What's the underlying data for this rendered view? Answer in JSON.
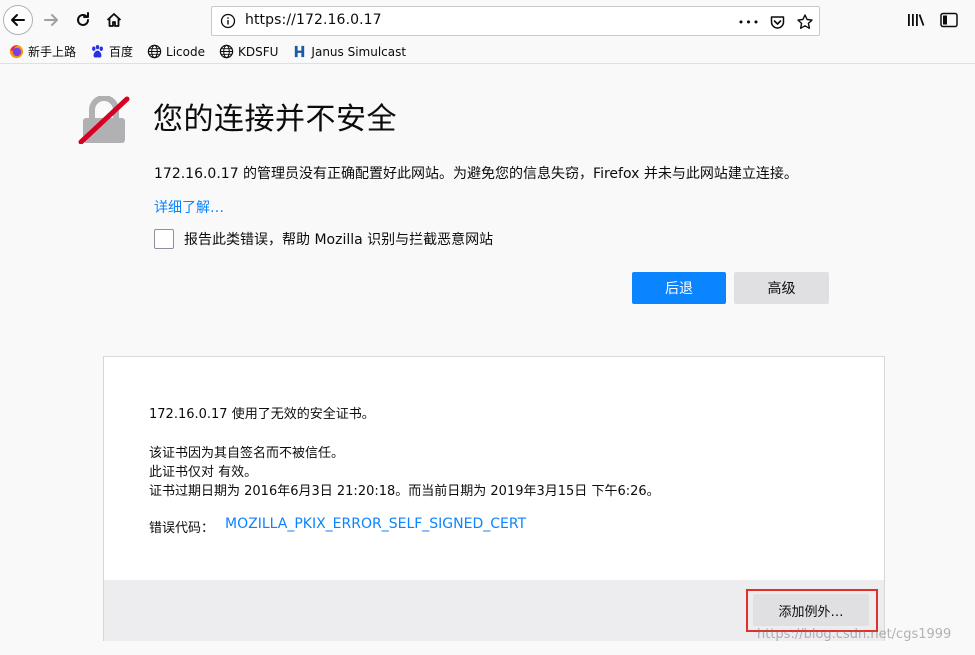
{
  "toolbar": {
    "url": "https://172.16.0.17",
    "more_glyph": "•••"
  },
  "bookmarks": [
    {
      "label": "新手上路",
      "icon": "firefox-icon"
    },
    {
      "label": "百度",
      "icon": "baidu-icon"
    },
    {
      "label": "Licode",
      "icon": "globe-icon"
    },
    {
      "label": "KDSFU",
      "icon": "globe-icon"
    },
    {
      "label": "Janus Simulcast",
      "icon": "janus-icon"
    }
  ],
  "error": {
    "title": "您的连接并不安全",
    "description": "172.16.0.17 的管理员没有正确配置好此网站。为避免您的信息失窃，Firefox 并未与此网站建立连接。",
    "learn_more": "详细了解…",
    "report_label": "报告此类错误，帮助 Mozilla 识别与拦截恶意网站",
    "back_button": "后退",
    "advanced_button": "高级"
  },
  "advanced": {
    "line1": "172.16.0.17 使用了无效的安全证书。",
    "line2": "该证书因为其自签名而不被信任。",
    "line3": "此证书仅对  有效。",
    "line4": "证书过期日期为 2016年6月3日 21:20:18。而当前日期为 2019年3月15日 下午6:26。",
    "error_code_label": "错误代码：",
    "error_code": "MOZILLA_PKIX_ERROR_SELF_SIGNED_CERT",
    "add_exception": "添加例外…"
  },
  "watermark": "https://blog.csdn.net/cgs1999",
  "colors": {
    "accent": "#0a84ff",
    "highlight": "#e0302c",
    "lock_slash": "#d70022"
  }
}
